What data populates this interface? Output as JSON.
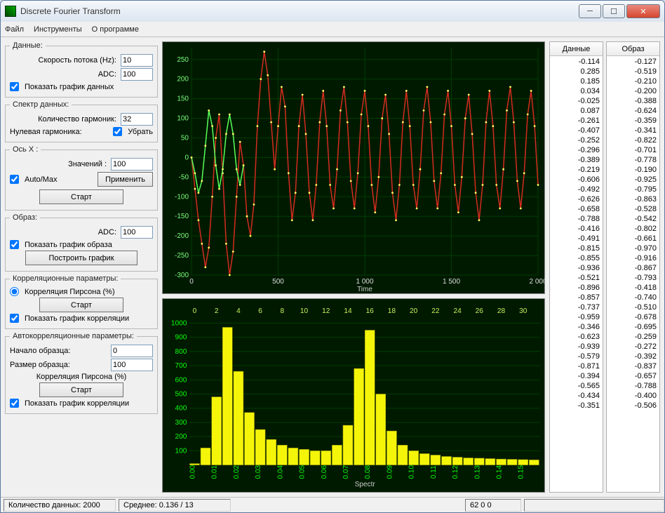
{
  "window": {
    "title": "Discrete Fourier Transform"
  },
  "menu": {
    "file": "Файл",
    "tools": "Инструменты",
    "about": "О программе"
  },
  "panel_data": {
    "legend": "Данные:",
    "speed_label": "Скорость потока (Hz):",
    "speed_value": "10",
    "adc_label": "ADC:",
    "adc_value": "100",
    "show_graph_label": "Показать график данных"
  },
  "panel_spectrum": {
    "legend": "Спектр данных:",
    "harmonics_label": "Количество гармоник:",
    "harmonics_value": "32",
    "zero_harm_label": "Нулевая гармоника:",
    "remove_label": "Убрать"
  },
  "panel_axisx": {
    "legend": "Ось X :",
    "values_label": "Значений :",
    "values_value": "100",
    "automax_label": "Auto/Max",
    "apply_label": "Применить",
    "start_label": "Старт"
  },
  "panel_image": {
    "legend": "Образ:",
    "adc_label": "ADC:",
    "adc_value": "100",
    "show_graph_label": "Показать график образа",
    "build_label": "Построить график"
  },
  "panel_corr": {
    "legend": "Корреляционные параметры:",
    "pearson_label": "Корреляция Пирсона (%)",
    "start_label": "Старт",
    "show_graph_label": "Показать график корреляции"
  },
  "panel_autocorr": {
    "legend": "Автокорреляционные параметры:",
    "begin_label": "Начало образца:",
    "begin_value": "0",
    "size_label": "Размер образца:",
    "size_value": "100",
    "pearson_label": "Корреляция Пирсона (%)",
    "start_label": "Старт",
    "show_graph_label": "Показать график корреляции"
  },
  "lists": {
    "data_header": "Данные",
    "image_header": "Образ",
    "data_values": [
      -0.114,
      0.285,
      0.185,
      0.034,
      -0.025,
      0.087,
      -0.261,
      -0.407,
      -0.252,
      -0.296,
      -0.389,
      -0.219,
      -0.606,
      -0.492,
      -0.626,
      -0.658,
      -0.788,
      -0.416,
      -0.491,
      -0.815,
      -0.855,
      -0.936,
      -0.521,
      -0.896,
      -0.857,
      -0.737,
      -0.959,
      -0.346,
      -0.623,
      -0.939,
      -0.579,
      -0.871,
      -0.394,
      -0.565,
      -0.434,
      -0.351
    ],
    "image_values": [
      -0.127,
      -0.519,
      -0.21,
      -0.2,
      -0.388,
      -0.624,
      -0.359,
      -0.341,
      -0.822,
      -0.701,
      -0.778,
      -0.19,
      -0.925,
      -0.795,
      -0.863,
      -0.528,
      -0.542,
      -0.802,
      -0.661,
      -0.97,
      -0.916,
      -0.867,
      -0.793,
      -0.418,
      -0.74,
      -0.51,
      -0.678,
      -0.695,
      -0.259,
      -0.272,
      -0.392,
      -0.837,
      -0.657,
      -0.788,
      -0.4,
      -0.506
    ]
  },
  "status": {
    "count_label": "Количество данных: 2000",
    "mean_label": "Среднее: 0.136 / 13",
    "right1": "62  0  0"
  },
  "chart_data": [
    {
      "type": "line",
      "title": "",
      "xlabel": "Time",
      "ylabel": "",
      "xlim": [
        0,
        2000
      ],
      "ylim": [
        -300,
        280
      ],
      "x_ticks": [
        0,
        500,
        1000,
        1500,
        2000
      ],
      "x_tick_labels": [
        "0",
        "500",
        "1 000",
        "1 500",
        "2 000"
      ],
      "y_ticks": [
        -300,
        -250,
        -200,
        -150,
        -100,
        -50,
        0,
        50,
        100,
        150,
        200,
        250
      ],
      "series": [
        {
          "name": "signal",
          "color": "#d42c1f",
          "x": [
            0,
            20,
            40,
            60,
            80,
            100,
            120,
            140,
            160,
            180,
            200,
            220,
            240,
            260,
            280,
            300,
            320,
            340,
            360,
            380,
            400,
            420,
            440,
            460,
            480,
            500,
            520,
            540,
            560,
            580,
            600,
            620,
            640,
            660,
            680,
            700,
            720,
            740,
            760,
            780,
            800,
            820,
            840,
            860,
            880,
            900,
            920,
            940,
            960,
            980,
            1000,
            1020,
            1040,
            1060,
            1080,
            1100,
            1120,
            1140,
            1160,
            1180,
            1200,
            1220,
            1240,
            1260,
            1280,
            1300,
            1320,
            1340,
            1360,
            1380,
            1400,
            1420,
            1440,
            1460,
            1480,
            1500,
            1520,
            1540,
            1560,
            1580,
            1600,
            1620,
            1640,
            1660,
            1680,
            1700,
            1720,
            1740,
            1760,
            1780,
            1800,
            1820,
            1840,
            1860,
            1880,
            1900,
            1920,
            1940,
            1960,
            1980,
            2000
          ],
          "y": [
            0,
            -80,
            -160,
            -220,
            -280,
            -230,
            -100,
            50,
            110,
            -40,
            -220,
            -300,
            -240,
            -100,
            40,
            -20,
            -150,
            -200,
            -120,
            80,
            200,
            270,
            210,
            90,
            -30,
            80,
            180,
            130,
            -40,
            -160,
            -90,
            80,
            160,
            60,
            -90,
            -160,
            -70,
            90,
            170,
            80,
            -70,
            -130,
            -30,
            120,
            180,
            90,
            -60,
            -130,
            -40,
            110,
            170,
            80,
            -70,
            -140,
            -50,
            100,
            160,
            60,
            -90,
            -160,
            -70,
            90,
            170,
            80,
            -70,
            -130,
            -30,
            120,
            180,
            90,
            -60,
            -130,
            -40,
            110,
            170,
            80,
            -70,
            -140,
            -50,
            100,
            160,
            60,
            -90,
            -160,
            -70,
            90,
            170,
            80,
            -70,
            -130,
            -30,
            120,
            180,
            90,
            -60,
            -130,
            -40,
            110,
            170,
            80,
            -70
          ]
        },
        {
          "name": "overlay",
          "color": "#5aff5a",
          "x": [
            0,
            20,
            40,
            60,
            80,
            100,
            120,
            140,
            160,
            180,
            200,
            220,
            240,
            260,
            280,
            300
          ],
          "y": [
            0,
            -40,
            -90,
            -60,
            30,
            120,
            80,
            -20,
            -80,
            -30,
            60,
            110,
            60,
            -30,
            -70,
            -20
          ]
        }
      ]
    },
    {
      "type": "bar",
      "title": "",
      "xlabel": "Spectr",
      "ylabel": "",
      "color": "#f5f50a",
      "xlim": [
        0,
        0.16
      ],
      "ylim": [
        0,
        1050
      ],
      "y_ticks": [
        100,
        200,
        300,
        400,
        500,
        600,
        700,
        800,
        900,
        1000
      ],
      "x_ticks_top": [
        0,
        2,
        4,
        6,
        8,
        10,
        12,
        14,
        16,
        18,
        20,
        22,
        24,
        26,
        28,
        30
      ],
      "x_ticks_bottom": [
        "0.00",
        "0.01",
        "0.02",
        "0.03",
        "0.04",
        "0.05",
        "0.06",
        "0.07",
        "0.08",
        "0.09",
        "0.10",
        "0.11",
        "0.12",
        "0.13",
        "0.14",
        "0.15"
      ],
      "categories": [
        0,
        1,
        2,
        3,
        4,
        5,
        6,
        7,
        8,
        9,
        10,
        11,
        12,
        13,
        14,
        15,
        16,
        17,
        18,
        19,
        20,
        21,
        22,
        23,
        24,
        25,
        26,
        27,
        28,
        29,
        30,
        31
      ],
      "values": [
        10,
        120,
        480,
        970,
        660,
        370,
        250,
        180,
        140,
        120,
        110,
        100,
        100,
        140,
        280,
        680,
        950,
        500,
        240,
        140,
        100,
        80,
        70,
        60,
        55,
        50,
        48,
        45,
        42,
        40,
        38,
        36
      ]
    }
  ]
}
